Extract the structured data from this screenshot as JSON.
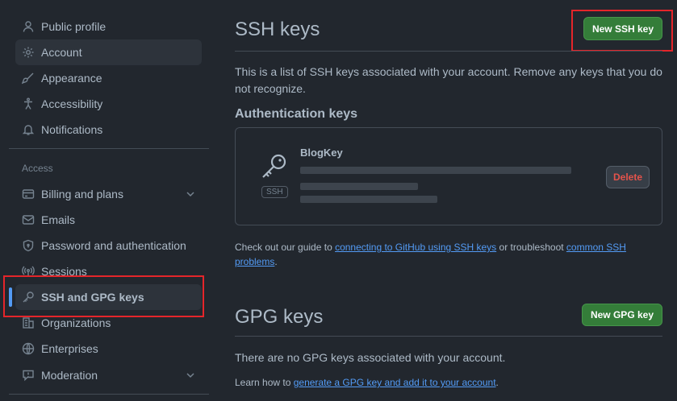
{
  "sidebar": {
    "items": [
      {
        "label": "Public profile",
        "icon": "person-icon"
      },
      {
        "label": "Account",
        "icon": "gear-icon"
      },
      {
        "label": "Appearance",
        "icon": "paintbrush-icon"
      },
      {
        "label": "Accessibility",
        "icon": "accessibility-icon"
      },
      {
        "label": "Notifications",
        "icon": "bell-icon"
      }
    ],
    "section_access": "Access",
    "access_items": [
      {
        "label": "Billing and plans",
        "icon": "credit-card-icon"
      },
      {
        "label": "Emails",
        "icon": "mail-icon"
      },
      {
        "label": "Password and authentication",
        "icon": "shield-lock-icon"
      },
      {
        "label": "Sessions",
        "icon": "broadcast-icon"
      },
      {
        "label": "SSH and GPG keys",
        "icon": "key-icon"
      },
      {
        "label": "Organizations",
        "icon": "organization-icon"
      },
      {
        "label": "Enterprises",
        "icon": "globe-icon"
      },
      {
        "label": "Moderation",
        "icon": "report-icon"
      }
    ]
  },
  "ssh": {
    "title": "SSH keys",
    "new_button": "New SSH key",
    "description": "This is a list of SSH keys associated with your account. Remove any keys that you do not recognize.",
    "auth_heading": "Authentication keys",
    "key": {
      "name": "BlogKey",
      "badge": "SSH",
      "delete_label": "Delete"
    },
    "guide_prefix": "Check out our guide to ",
    "guide_link": "connecting to GitHub using SSH keys",
    "guide_middle": " or troubleshoot ",
    "guide_link2": "common SSH problems",
    "guide_suffix": "."
  },
  "gpg": {
    "title": "GPG keys",
    "new_button": "New GPG key",
    "empty_text": "There are no GPG keys associated with your account.",
    "learn_prefix": "Learn how to ",
    "learn_link": "generate a GPG key and add it to your account",
    "learn_suffix": "."
  }
}
